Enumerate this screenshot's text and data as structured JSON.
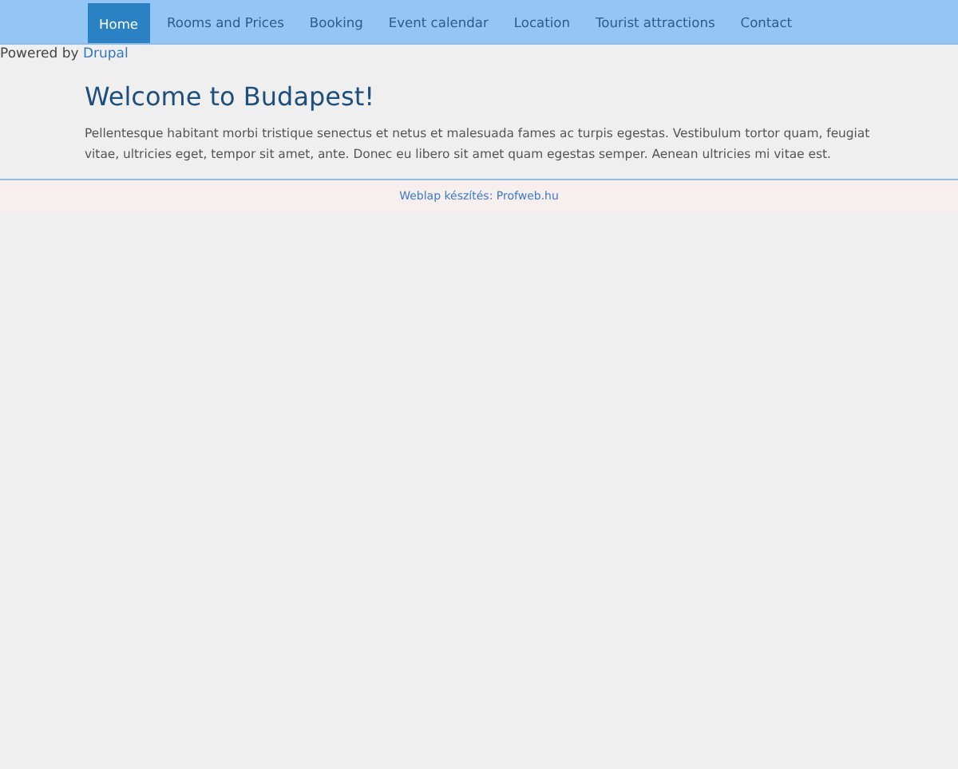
{
  "nav": [
    {
      "label": "Home",
      "selected": true
    },
    {
      "label": "Rooms and Prices",
      "selected": false
    },
    {
      "label": "Booking",
      "selected": false
    },
    {
      "label": "Event calendar",
      "selected": false
    },
    {
      "label": "Location",
      "selected": false
    },
    {
      "label": "Tourist attractions",
      "selected": false
    },
    {
      "label": "Contact",
      "selected": false
    }
  ],
  "powered_by": {
    "text": "Powered by",
    "link": "Drupal"
  },
  "page": {
    "title": "Welcome to Budapest!",
    "body": "Pellentesque habitant morbi tristique senectus et netus et malesuada fames ac turpis egestas. Vestibulum tortor quam, feugiat vitae, ultricies eget, tempor sit amet, ante. Donec eu libero sit amet quam egestas semper. Aenean ultricies mi vitae est."
  },
  "footer": {
    "credit": "Weblap készítés: Profweb.hu"
  }
}
